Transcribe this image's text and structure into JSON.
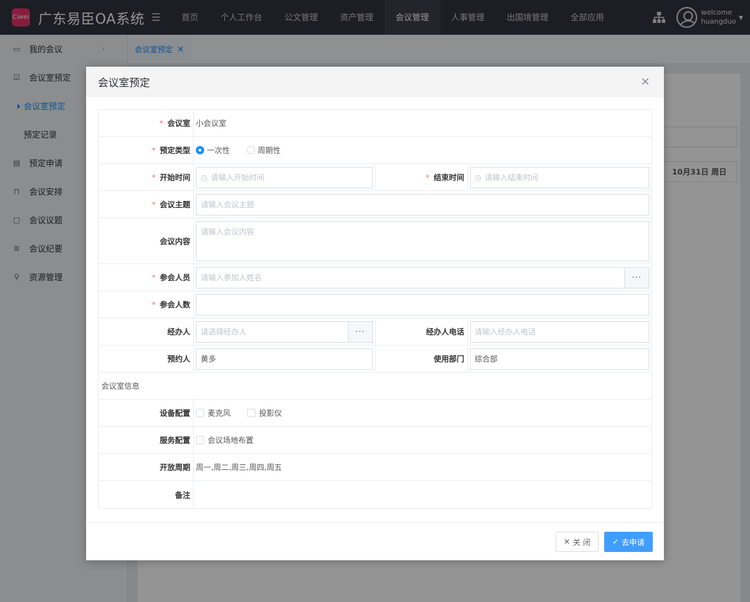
{
  "app": {
    "title": "广东易臣OA系统",
    "logo_text": "Ciwei",
    "accent": "#1890ff"
  },
  "nav": {
    "items": [
      {
        "label": "首页"
      },
      {
        "label": "个人工作台"
      },
      {
        "label": "公文管理"
      },
      {
        "label": "资产管理"
      },
      {
        "label": "会议管理"
      },
      {
        "label": "人事管理"
      },
      {
        "label": "出国境管理"
      },
      {
        "label": "全部应用"
      }
    ],
    "active": "会议管理"
  },
  "user": {
    "welcome": "welcome",
    "name": "huangduo"
  },
  "sidebar": {
    "items": [
      {
        "label": "我的会议",
        "icon": "monitor-icon"
      },
      {
        "label": "会议室预定",
        "icon": "calendar-check-icon"
      },
      {
        "label": "会议室预定",
        "icon": ""
      },
      {
        "label": "预定记录",
        "icon": ""
      },
      {
        "label": "预定申请",
        "icon": "form-icon"
      },
      {
        "label": "会议安排",
        "icon": "seat-icon"
      },
      {
        "label": "会议议题",
        "icon": "chat-icon"
      },
      {
        "label": "会议纪要",
        "icon": "list-icon"
      },
      {
        "label": "资源管理",
        "icon": "pin-icon"
      }
    ]
  },
  "tabs": {
    "active_label": "会议室预定"
  },
  "background": {
    "date_text": "10月31日 周日"
  },
  "modal": {
    "title": "会议室预定",
    "fields": {
      "room": {
        "label": "会议室",
        "value": "小会议室"
      },
      "type": {
        "label": "预定类型",
        "options": [
          "一次性",
          "周期性"
        ],
        "selected": "一次性"
      },
      "start": {
        "label": "开始时间",
        "placeholder": "请输入开始时间"
      },
      "end": {
        "label": "结束时间",
        "placeholder": "请输入结束时间"
      },
      "topic": {
        "label": "会议主题",
        "placeholder": "请输入会议主题"
      },
      "content": {
        "label": "会议内容",
        "placeholder": "请输入会议内容"
      },
      "attendees": {
        "label": "参会人员",
        "placeholder": "请输入参加人姓名"
      },
      "count": {
        "label": "参会人数",
        "value": ""
      },
      "handler": {
        "label": "经办人",
        "placeholder": "请选择经办人"
      },
      "handler_phone": {
        "label": "经办人电话",
        "placeholder": "请输入经办人电话"
      },
      "booker": {
        "label": "预约人",
        "value": "黄多"
      },
      "dept": {
        "label": "使用部门",
        "value": "综合部"
      }
    },
    "room_info": {
      "section_title": "会议室信息",
      "equipment": {
        "label": "设备配置",
        "options": [
          "麦克风",
          "投影仪"
        ]
      },
      "service": {
        "label": "服务配置",
        "options": [
          "会议场地布置"
        ]
      },
      "open_period": {
        "label": "开放周期",
        "value": "周一,周二,周三,周四,周五"
      },
      "remark": {
        "label": "备注",
        "value": ""
      }
    },
    "buttons": {
      "close": "关 闭",
      "apply": "去申请"
    }
  }
}
